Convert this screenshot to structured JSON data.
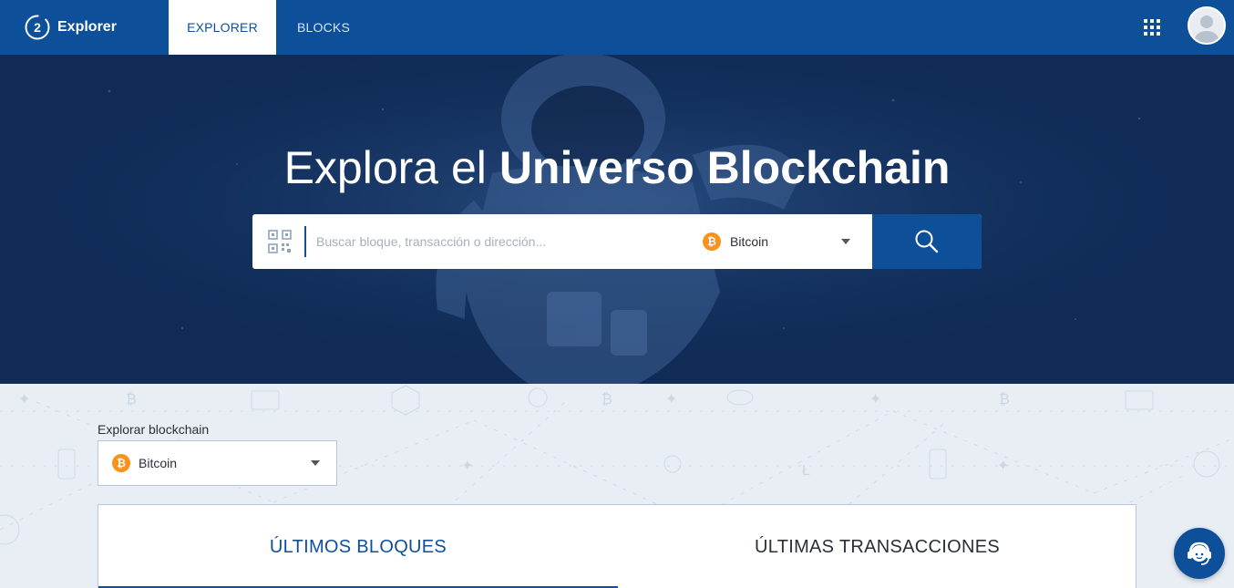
{
  "header": {
    "brand_badge": "2",
    "brand_name": "Explorer",
    "tabs": [
      {
        "label": "EXPLORER",
        "active": true
      },
      {
        "label": "BLOCKS",
        "active": false
      }
    ]
  },
  "hero": {
    "title_light": "Explora el",
    "title_bold": "Universo Blockchain",
    "search": {
      "placeholder": "Buscar bloque, transacción o dirección...",
      "selected_coin": "Bitcoin",
      "coin_symbol": "₿"
    }
  },
  "explorer": {
    "label": "Explorar blockchain",
    "selected_coin": "Bitcoin",
    "coin_symbol": "₿"
  },
  "tabs": [
    {
      "label": "ÚLTIMOS BLOQUES",
      "active": true
    },
    {
      "label": "ÚLTIMAS TRANSACCIONES",
      "active": false
    }
  ],
  "colors": {
    "primary": "#0e4f9a",
    "hero_bg": "#0f2b56",
    "page_bg": "#e9eef5",
    "bitcoin": "#f7931a"
  },
  "icons": {
    "logo": "brand-logo-icon",
    "apps": "apps-grid-icon",
    "user": "user-avatar-icon",
    "qr": "qr-code-icon",
    "search": "search-icon",
    "support": "support-headset-icon"
  }
}
